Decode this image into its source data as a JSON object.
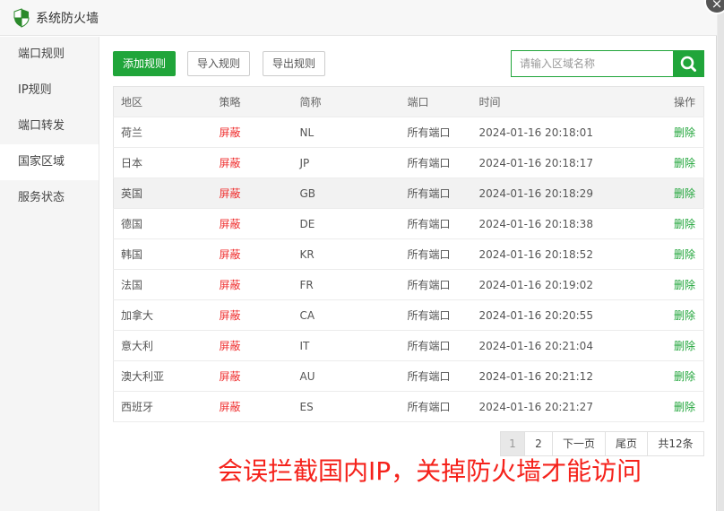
{
  "window": {
    "title": "系统防火墙",
    "close_glyph": "×"
  },
  "sidebar": {
    "items": [
      {
        "label": "端口规则"
      },
      {
        "label": "IP规则"
      },
      {
        "label": "端口转发"
      },
      {
        "label": "国家区域"
      },
      {
        "label": "服务状态"
      }
    ],
    "active_index": 3
  },
  "toolbar": {
    "add_label": "添加规则",
    "import_label": "导入规则",
    "export_label": "导出规则"
  },
  "search": {
    "placeholder": "请输入区域名称",
    "value": "",
    "icon": "search-icon"
  },
  "table": {
    "headers": [
      "地区",
      "策略",
      "简称",
      "端口",
      "时间",
      "操作"
    ],
    "rows": [
      {
        "region": "荷兰",
        "policy": "屏蔽",
        "code": "NL",
        "port": "所有端口",
        "time": "2024-01-16 20:18:01",
        "action": "删除"
      },
      {
        "region": "日本",
        "policy": "屏蔽",
        "code": "JP",
        "port": "所有端口",
        "time": "2024-01-16 20:18:17",
        "action": "删除"
      },
      {
        "region": "英国",
        "policy": "屏蔽",
        "code": "GB",
        "port": "所有端口",
        "time": "2024-01-16 20:18:29",
        "action": "删除"
      },
      {
        "region": "德国",
        "policy": "屏蔽",
        "code": "DE",
        "port": "所有端口",
        "time": "2024-01-16 20:18:38",
        "action": "删除"
      },
      {
        "region": "韩国",
        "policy": "屏蔽",
        "code": "KR",
        "port": "所有端口",
        "time": "2024-01-16 20:18:52",
        "action": "删除"
      },
      {
        "region": "法国",
        "policy": "屏蔽",
        "code": "FR",
        "port": "所有端口",
        "time": "2024-01-16 20:19:02",
        "action": "删除"
      },
      {
        "region": "加拿大",
        "policy": "屏蔽",
        "code": "CA",
        "port": "所有端口",
        "time": "2024-01-16 20:20:55",
        "action": "删除"
      },
      {
        "region": "意大利",
        "policy": "屏蔽",
        "code": "IT",
        "port": "所有端口",
        "time": "2024-01-16 20:21:04",
        "action": "删除"
      },
      {
        "region": "澳大利亚",
        "policy": "屏蔽",
        "code": "AU",
        "port": "所有端口",
        "time": "2024-01-16 20:21:12",
        "action": "删除"
      },
      {
        "region": "西班牙",
        "policy": "屏蔽",
        "code": "ES",
        "port": "所有端口",
        "time": "2024-01-16 20:21:27",
        "action": "删除"
      }
    ]
  },
  "pagination": {
    "page1": "1",
    "page2": "2",
    "next": "下一页",
    "last": "尾页",
    "total": "共12条"
  },
  "annotation": "会误拦截国内IP，关掉防火墙才能访问",
  "colors": {
    "accent": "#20a53a",
    "block": "#ef2e2e",
    "annotation": "#f5221b"
  }
}
